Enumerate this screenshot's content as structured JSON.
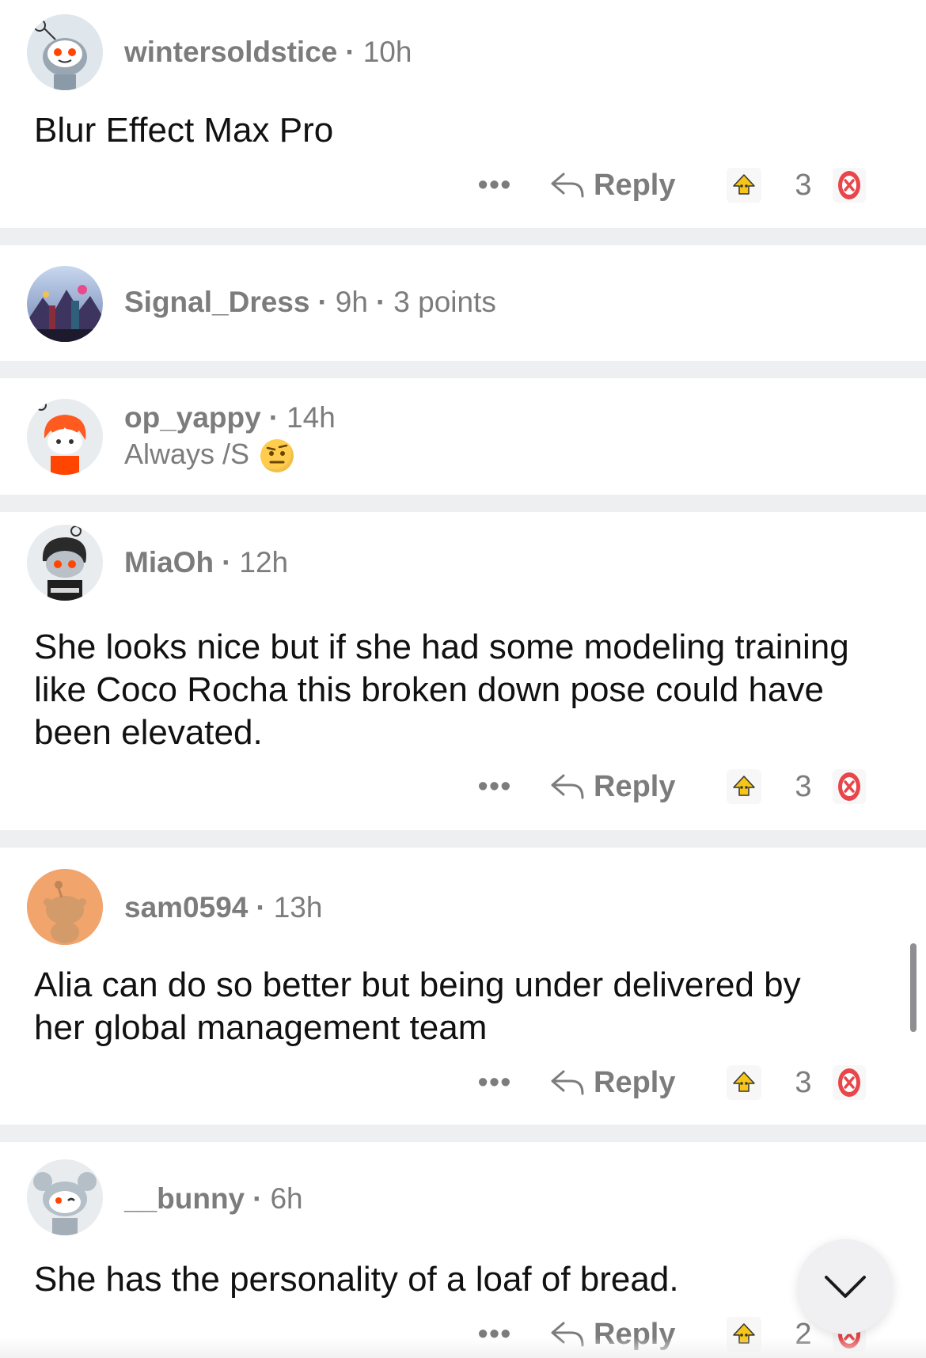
{
  "comments": [
    {
      "username": "wintersoldstice",
      "age": "10h",
      "body": "Blur Effect Max Pro",
      "actions": {
        "more": "•••",
        "reply_label": "Reply",
        "score": "3"
      }
    },
    {
      "username": "Signal_Dress",
      "age": "9h",
      "points": "3 points"
    },
    {
      "username": "op_yappy",
      "age": "14h",
      "flair": "Always /S"
    },
    {
      "username": "MiaOh",
      "age": "12h",
      "body": "She looks nice but if she had some modeling training like Coco Rocha this broken down pose could have been elevated.",
      "actions": {
        "more": "•••",
        "reply_label": "Reply",
        "score": "3"
      }
    },
    {
      "username": "sam0594",
      "age": "13h",
      "body": "Alia can do so better but being under delivered by her global management team",
      "actions": {
        "more": "•••",
        "reply_label": "Reply",
        "score": "3"
      }
    },
    {
      "username": "__bunny",
      "age": "6h",
      "body": "She has the personality of a loaf of bread.",
      "actions": {
        "more": "•••",
        "reply_label": "Reply",
        "score": "2"
      }
    }
  ],
  "colors": {
    "divider": "#edeff1",
    "meta_text": "#7c7c7c",
    "upvote_award": "#f5c518",
    "downvote_award": "#e8464a",
    "orange_avatar_bg": "#f1a46b"
  },
  "icons": {
    "reply": "reply-arrow-icon",
    "upvote": "upvote-award-icon",
    "downvote": "downvote-award-icon",
    "more": "more-dots-icon",
    "scroll_down": "chevron-down-icon"
  }
}
